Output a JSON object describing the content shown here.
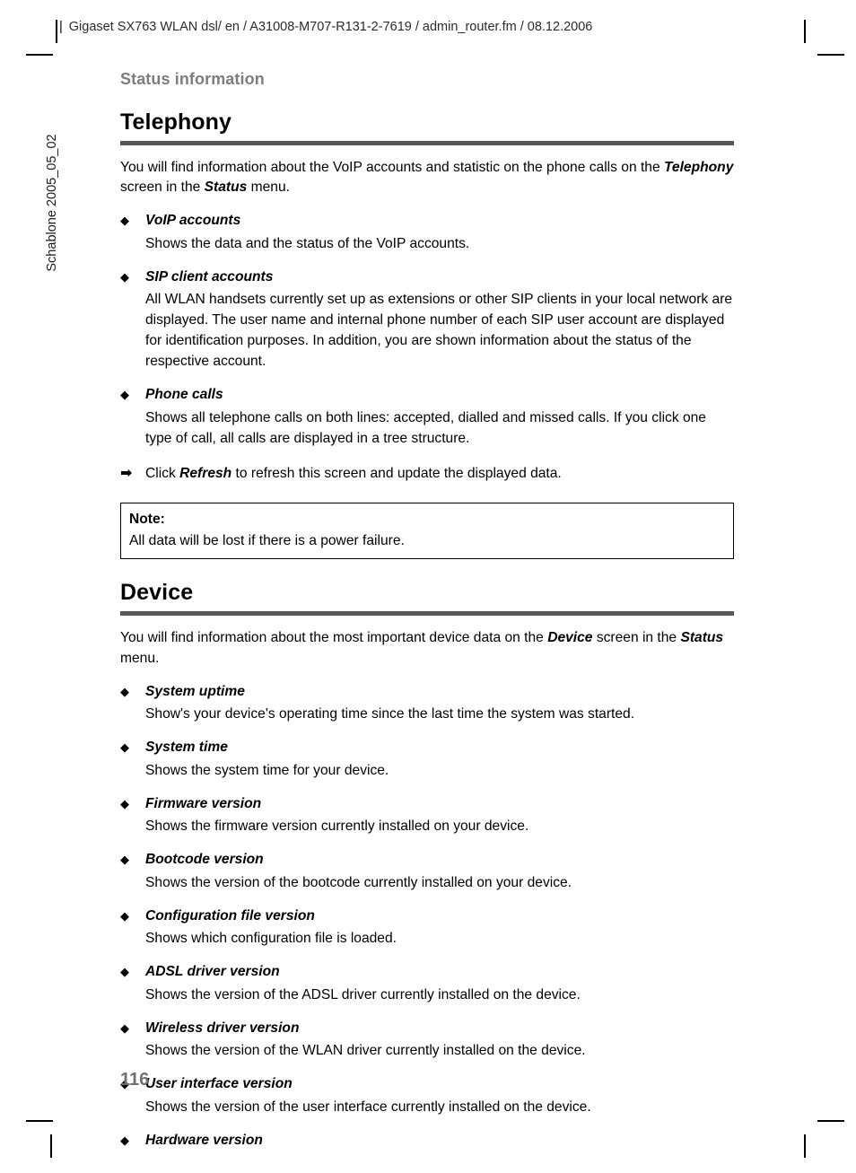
{
  "header": {
    "separator": "|",
    "text": "Gigaset SX763 WLAN dsl/ en / A31008-M707-R131-2-7619 / admin_router.fm / 08.12.2006"
  },
  "side_label": "Schablone 2005_05_02",
  "chapter": "Status information",
  "page_number": "116",
  "colors": {
    "rule": "#575757",
    "chapter_gray": "#7d7d7d",
    "page_number_gray": "#6f6f6f"
  },
  "icons": {
    "bullet": "◆",
    "arrow": "➡"
  },
  "sections": [
    {
      "title": "Telephony",
      "intro_parts": [
        {
          "text": "You will find information about the VoIP accounts and statistic on the phone calls on the ",
          "style": "normal"
        },
        {
          "text": "Telephony",
          "style": "bold-italic"
        },
        {
          "text": " screen in the ",
          "style": "normal"
        },
        {
          "text": "Status",
          "style": "bold-italic"
        },
        {
          "text": " menu.",
          "style": "normal"
        }
      ],
      "bullets": [
        {
          "term": "VoIP accounts",
          "desc": "Shows the data and the status of the VoIP accounts."
        },
        {
          "term": "SIP client accounts",
          "desc": "All WLAN handsets currently set up as extensions or other SIP clients in your local network are displayed. The user name and internal phone number of each SIP user account are displayed for identification purposes. In addition, you are shown information about the status of the respective account."
        },
        {
          "term": "Phone calls",
          "desc": "Shows all telephone calls on both lines: accepted, dialled and missed calls. If you click one type of call, all calls are displayed in a tree structure."
        }
      ],
      "step_parts": [
        {
          "text": "Click ",
          "style": "normal"
        },
        {
          "text": "Refresh",
          "style": "bold-italic"
        },
        {
          "text": " to refresh this screen and update the displayed data.",
          "style": "normal"
        }
      ],
      "note": {
        "title": "Note:",
        "text": "All data will be lost if there is a power failure."
      }
    },
    {
      "title": "Device",
      "intro_parts": [
        {
          "text": "You will find information about the most important device data on the ",
          "style": "normal"
        },
        {
          "text": "Device",
          "style": "bold-italic"
        },
        {
          "text": " screen in the ",
          "style": "normal"
        },
        {
          "text": "Status",
          "style": "bold-italic"
        },
        {
          "text": " menu.",
          "style": "normal"
        }
      ],
      "bullets": [
        {
          "term": "System uptime",
          "desc": "Show's your device's operating time since the last time the system was started."
        },
        {
          "term": "System time",
          "desc": "Shows the system time for your device."
        },
        {
          "term": "Firmware version",
          "desc": "Shows the firmware version currently installed on your device."
        },
        {
          "term": "Bootcode version",
          "desc": "Shows the version of the bootcode currently installed on your device."
        },
        {
          "term": "Configuration file version",
          "desc": "Shows which configuration file is loaded."
        },
        {
          "term": "ADSL driver version",
          "desc": "Shows the version of the ADSL driver currently installed on the device."
        },
        {
          "term": "Wireless driver version",
          "desc": "Shows the version of the WLAN driver currently installed on the device."
        },
        {
          "term": "User interface version",
          "desc": "Shows the version of the user interface currently installed on the device."
        },
        {
          "term": "Hardware version",
          "desc": ""
        }
      ]
    }
  ]
}
